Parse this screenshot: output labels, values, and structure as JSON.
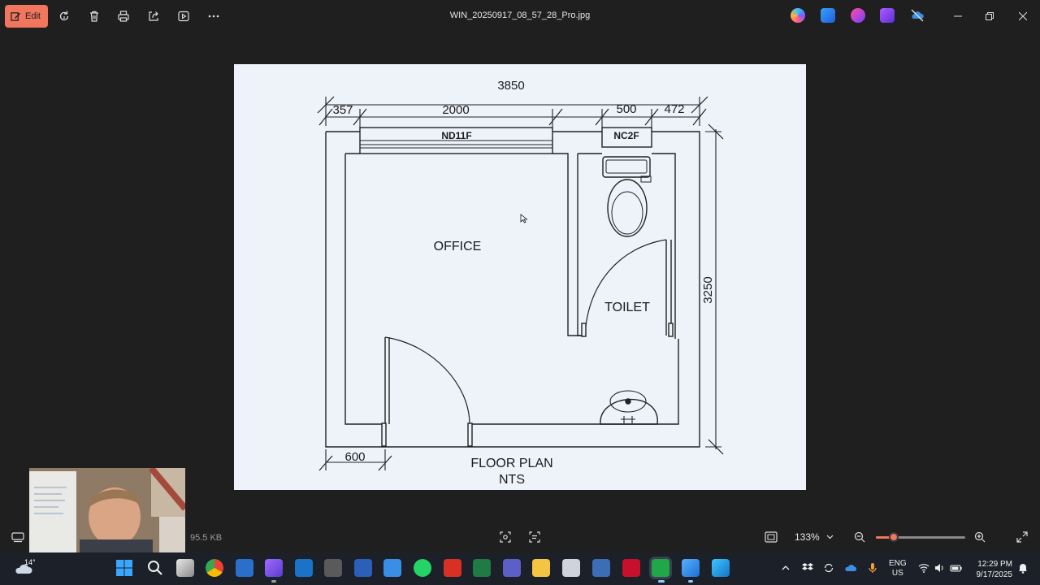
{
  "titlebar": {
    "edit_label": "Edit",
    "file_name": "WIN_20250917_08_57_28_Pro.jpg",
    "icons": [
      "rotate-icon",
      "delete-icon",
      "print-icon",
      "share-icon",
      "slideshow-icon",
      "more-icon"
    ],
    "app_icons": [
      "copilot-icon",
      "designer-icon",
      "clipchamp-icon",
      "photos-app-icon",
      "onedrive-off-icon"
    ],
    "window_controls": [
      "minimize-icon",
      "restore-icon",
      "close-icon"
    ]
  },
  "drawing": {
    "dim_overall_width": "3850",
    "dim_left_segment": "357",
    "dim_window": "2000",
    "dim_toilet_window": "500",
    "dim_right_segment": "472",
    "dim_height": "3250",
    "dim_door_offset": "600",
    "window_office_tag": "ND11F",
    "window_toilet_tag": "NC2F",
    "room_office": "OFFICE",
    "room_toilet": "TOILET",
    "title": "FLOOR PLAN",
    "scale_note": "NTS"
  },
  "statusbar": {
    "file_size": "95.5 KB",
    "zoom": "133%",
    "zoom_fraction": 0.2
  },
  "taskbar": {
    "temperature": "14°",
    "language": "ENG",
    "region": "US",
    "time": "12:29 PM",
    "date": "9/17/2025"
  },
  "colors": {
    "accent": "#f0765d",
    "background": "#1f1f1f",
    "taskbar": "#1c2028",
    "paper": "#eef2f9"
  }
}
